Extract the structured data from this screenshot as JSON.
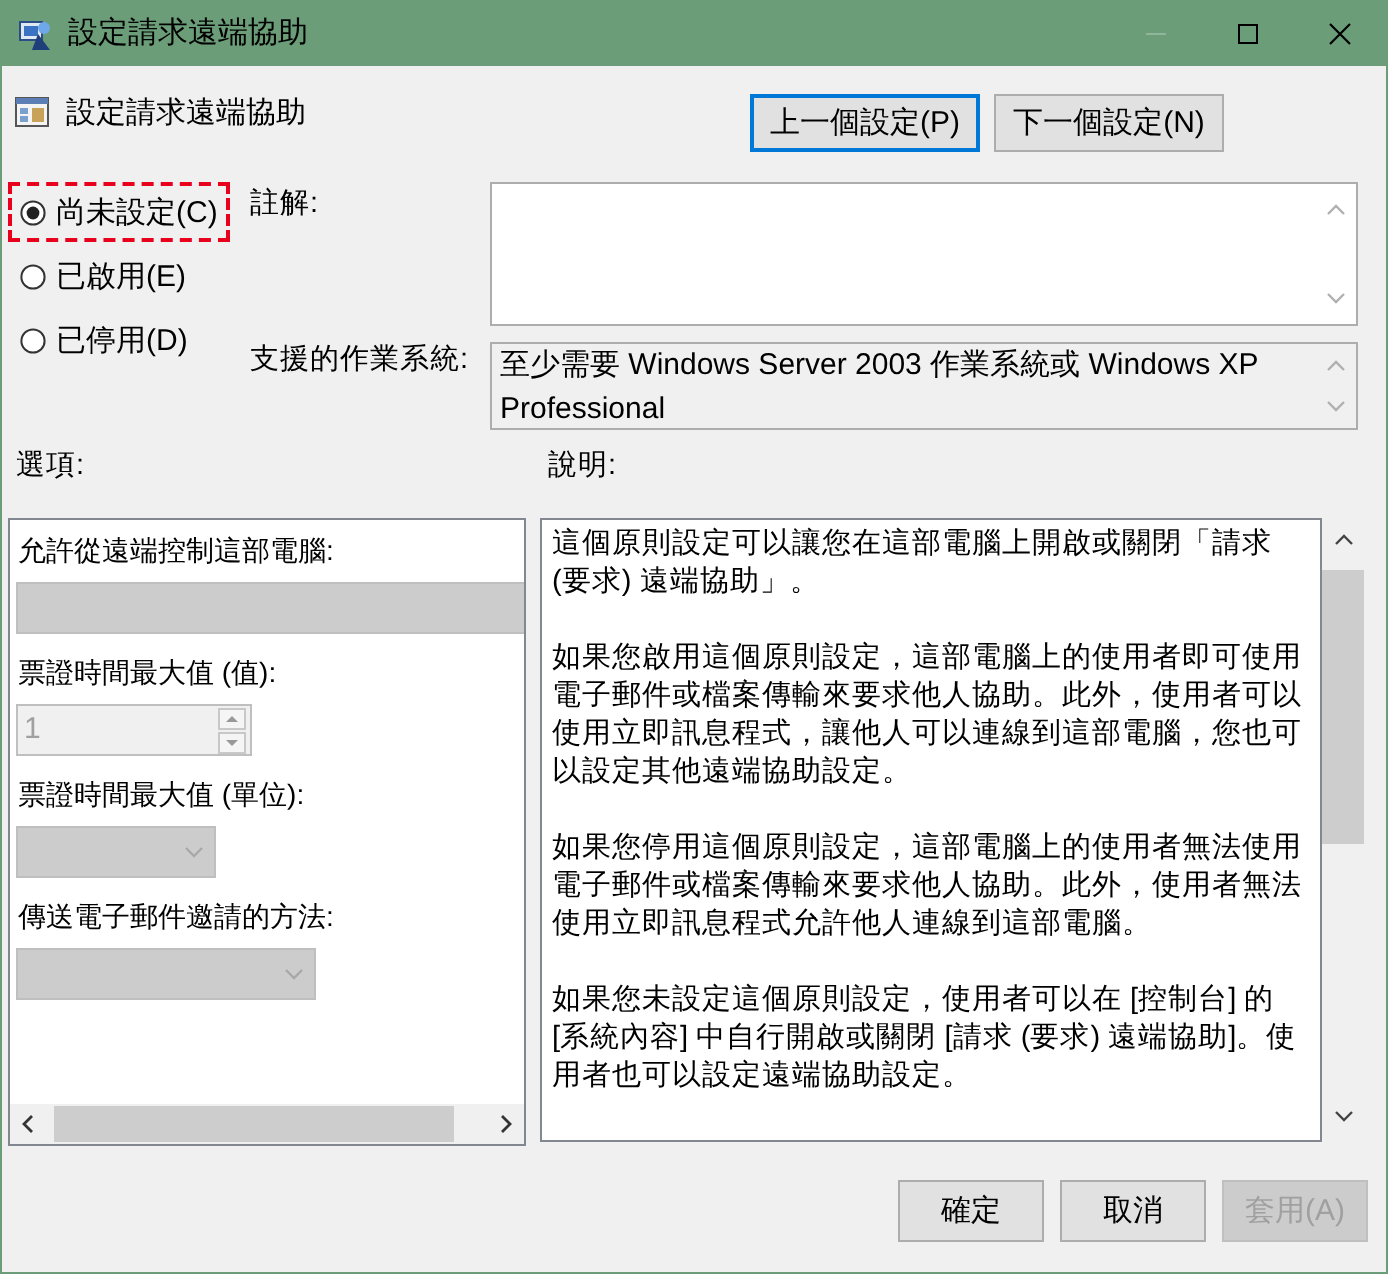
{
  "window": {
    "title": "設定請求遠端協助"
  },
  "header": {
    "title": "設定請求遠端協助"
  },
  "nav_buttons": [
    {
      "label": "上一個設定(P)",
      "focused": true
    },
    {
      "label": "下一個設定(N)",
      "focused": false
    }
  ],
  "state_options": [
    {
      "label": "尚未設定(C)",
      "selected": true,
      "highlighted": true
    },
    {
      "label": "已啟用(E)",
      "selected": false,
      "highlighted": false
    },
    {
      "label": "已停用(D)",
      "selected": false,
      "highlighted": false
    }
  ],
  "comment": {
    "label": "註解:"
  },
  "supported_on": {
    "label": "支援的作業系統:",
    "value": "至少需要 Windows Server 2003 作業系統或 Windows XP Professional"
  },
  "options": {
    "label": "選項:",
    "items": [
      {
        "kind": "dropdown",
        "label": "允許從遠端控制這部電腦:"
      },
      {
        "kind": "spinner",
        "label": "票證時間最大值 (值):",
        "value": "1"
      },
      {
        "kind": "dropdown",
        "label": "票證時間最大值 (單位):"
      },
      {
        "kind": "dropdown",
        "label": "傳送電子郵件邀請的方法:"
      }
    ]
  },
  "help": {
    "label": "說明:",
    "paragraphs": [
      "這個原則設定可以讓您在這部電腦上開啟或關閉「請求 (要求) 遠端協助」。",
      "如果您啟用這個原則設定，這部電腦上的使用者即可使用電子郵件或檔案傳輸來要求他人協助。此外，使用者可以使用立即訊息程式，讓他人可以連線到這部電腦，您也可以設定其他遠端協助設定。",
      "如果您停用這個原則設定，這部電腦上的使用者無法使用電子郵件或檔案傳輸來要求他人協助。此外，使用者無法使用立即訊息程式允許他人連線到這部電腦。",
      "如果您未設定這個原則設定，使用者可以在 [控制台] 的 [系統內容] 中自行開啟或關閉 [請求 (要求) 遠端協助]。使用者也可以設定遠端協助設定。"
    ]
  },
  "dialog_buttons": [
    {
      "label": "確定",
      "disabled": false
    },
    {
      "label": "取消",
      "disabled": false
    },
    {
      "label": "套用(A)",
      "disabled": true
    }
  ]
}
